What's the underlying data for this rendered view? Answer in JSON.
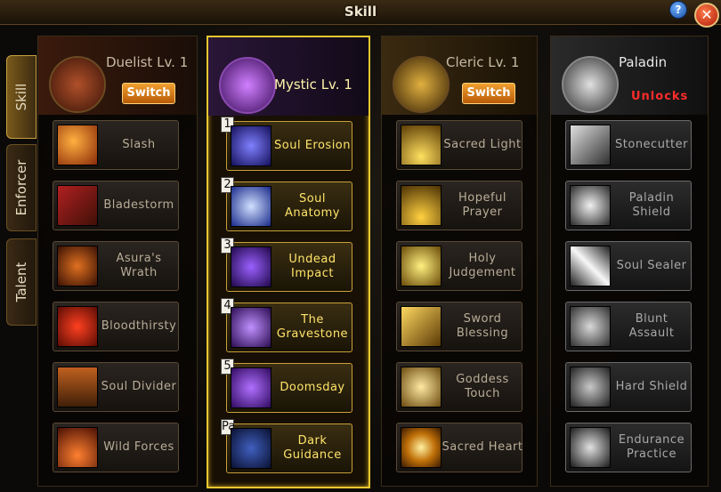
{
  "window": {
    "title": "Skill"
  },
  "controls": {
    "help": "?",
    "close": "✕"
  },
  "side_tabs": [
    {
      "label": "Skill",
      "active": true
    },
    {
      "label": "Enforcer",
      "active": false
    },
    {
      "label": "Talent",
      "active": false
    }
  ],
  "classes": [
    {
      "name": "Duelist Lv. 1",
      "button": "Switch",
      "emblem_icon": "duelist-helmet-icon",
      "active": false,
      "skills": [
        "Slash",
        "Bladestorm",
        "Asura's Wrath",
        "Bloodthirsty",
        "Soul Divider",
        "Wild Forces"
      ]
    },
    {
      "name": "Mystic Lv. 1",
      "emblem_icon": "mystic-skull-icon",
      "active": true,
      "skills": [
        "Soul Erosion",
        "Soul Anatomy",
        "Undead Impact",
        "The Gravestone",
        "Doomsday",
        "Dark Guidance"
      ],
      "slot_numbers": [
        "1",
        "2",
        "3",
        "4",
        "5",
        "Pa"
      ]
    },
    {
      "name": "Cleric Lv. 1",
      "button": "Switch",
      "emblem_icon": "cleric-flame-icon",
      "active": false,
      "skills": [
        "Sacred Light",
        "Hopeful Prayer",
        "Holy Judgement",
        "Sword Blessing",
        "Goddess Touch",
        "Sacred Heart"
      ]
    },
    {
      "name": "Paladin",
      "status": "Unlocks",
      "emblem_icon": "paladin-shield-icon",
      "active": false,
      "skills": [
        "Stonecutter",
        "Paladin Shield",
        "Soul Sealer",
        "Blunt Assault",
        "Hard Shield",
        "Endurance Practice"
      ]
    }
  ],
  "colors": {
    "active_border": "#e8c830",
    "locked_text": "#ff2c2c",
    "switch_button": "#e08a20"
  }
}
